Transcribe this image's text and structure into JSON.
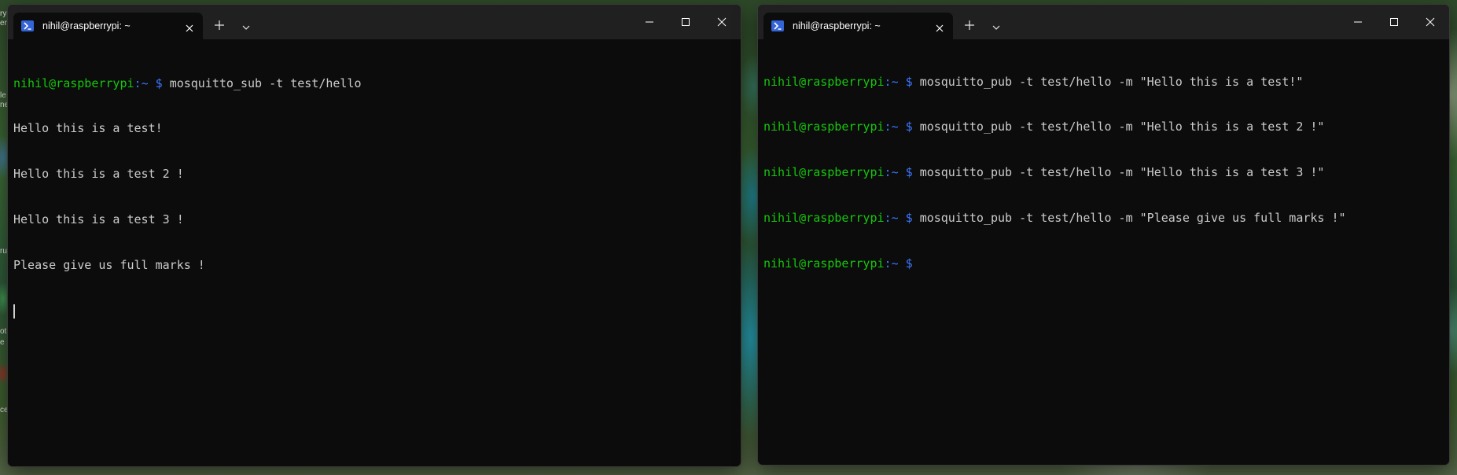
{
  "desktop": {
    "edge_fragments": [
      "ry",
      "er",
      "le",
      "ne",
      "ru",
      "ot",
      "e",
      "ce"
    ]
  },
  "windows": [
    {
      "tab_title": "nihil@raspberrypi: ~",
      "prompt": {
        "user_host": "nihil@raspberrypi",
        "sep": ":",
        "path": "~",
        "dollar": "$"
      },
      "command": "mosquitto_sub -t test/hello",
      "output": [
        "Hello this is a test!",
        "Hello this is a test 2 !",
        "Hello this is a test 3 !",
        "Please give us full marks !"
      ]
    },
    {
      "tab_title": "nihil@raspberrypi: ~",
      "prompt": {
        "user_host": "nihil@raspberrypi",
        "sep": ":",
        "path": "~",
        "dollar": "$"
      },
      "commands": [
        "mosquitto_pub -t test/hello -m \"Hello this is a test!\"",
        "mosquitto_pub -t test/hello -m \"Hello this is a test 2 !\"",
        "mosquitto_pub -t test/hello -m \"Hello this is a test 3 !\"",
        "mosquitto_pub -t test/hello -m \"Please give us full marks !\""
      ]
    }
  ],
  "colors": {
    "terminal_bg": "#0c0c0c",
    "titlebar_bg": "#202020",
    "prompt_user": "#16c60c",
    "prompt_path": "#3b78ff",
    "text": "#cccccc"
  }
}
